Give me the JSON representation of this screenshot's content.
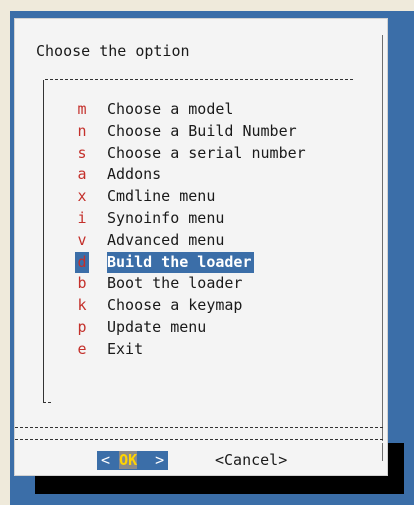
{
  "dialog": {
    "title": "Choose the option",
    "menu_items": [
      {
        "key": "m",
        "label": "Choose a model",
        "selected": false
      },
      {
        "key": "n",
        "label": "Choose a Build Number",
        "selected": false
      },
      {
        "key": "s",
        "label": "Choose a serial number",
        "selected": false
      },
      {
        "key": "a",
        "label": "Addons",
        "selected": false
      },
      {
        "key": "x",
        "label": "Cmdline menu",
        "selected": false
      },
      {
        "key": "i",
        "label": "Synoinfo menu",
        "selected": false
      },
      {
        "key": "v",
        "label": "Advanced menu",
        "selected": false
      },
      {
        "key": "d",
        "label": "Build the loader",
        "selected": true
      },
      {
        "key": "b",
        "label": "Boot the loader",
        "selected": false
      },
      {
        "key": "k",
        "label": "Choose a keymap",
        "selected": false
      },
      {
        "key": "p",
        "label": "Update menu",
        "selected": false
      },
      {
        "key": "e",
        "label": "Exit",
        "selected": false
      }
    ],
    "buttons": {
      "ok_left": "< ",
      "ok_hot": "O",
      "ok_rest": "K",
      "ok_right": "  >",
      "cancel": "<Cancel>"
    }
  },
  "colors": {
    "screen_background": "#3b6ea8",
    "dialog_background": "#f4f4f4",
    "hotkey": "#c4302b",
    "selection": "#3b6ea8"
  }
}
